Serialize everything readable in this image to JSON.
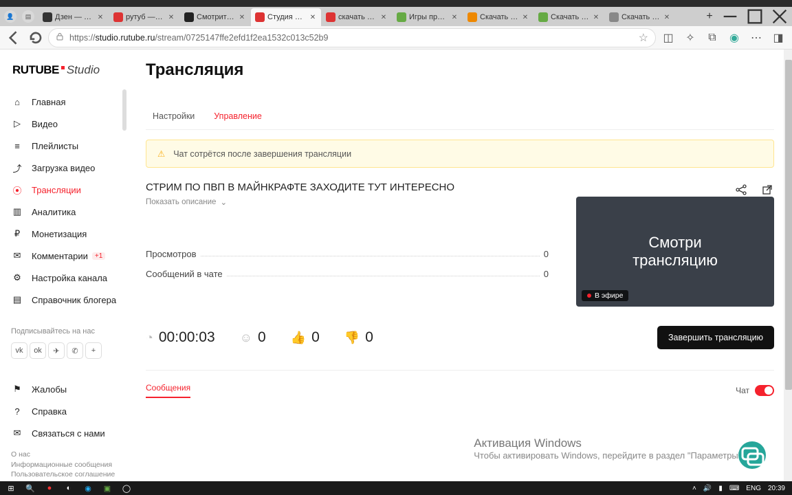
{
  "browser": {
    "tabs": [
      {
        "label": "Дзен — пла",
        "color": "#333"
      },
      {
        "label": "рутуб — Ян",
        "color": "#d33"
      },
      {
        "label": "Смотрите в",
        "color": "#222"
      },
      {
        "label": "Студия RUT",
        "color": "#d33",
        "active": true
      },
      {
        "label": "скачать игр",
        "color": "#d33"
      },
      {
        "label": "Игры про в",
        "color": "#6a4"
      },
      {
        "label": "Скачать игр",
        "color": "#e80"
      },
      {
        "label": "Скачать игр",
        "color": "#6a4"
      },
      {
        "label": "Скачать фа",
        "color": "#888"
      }
    ],
    "url_prefix": "https://",
    "url_host": "studio.rutube.ru",
    "url_path": "/stream/0725147ffe2efd1f2ea1532c013c52b9"
  },
  "logo": {
    "brand": "RUTUBE",
    "suffix": "Studio"
  },
  "sidebar": {
    "items": [
      {
        "label": "Главная",
        "icon": "home"
      },
      {
        "label": "Видео",
        "icon": "play"
      },
      {
        "label": "Плейлисты",
        "icon": "list"
      },
      {
        "label": "Загрузка видео",
        "icon": "upload"
      },
      {
        "label": "Трансляции",
        "icon": "broadcast",
        "active": true
      },
      {
        "label": "Аналитика",
        "icon": "chart"
      },
      {
        "label": "Монетизация",
        "icon": "ruble"
      },
      {
        "label": "Комментарии",
        "icon": "comment",
        "badge": "+1"
      },
      {
        "label": "Настройка канала",
        "icon": "gear"
      },
      {
        "label": "Справочник блогера",
        "icon": "book"
      }
    ],
    "subscribe": "Подписывайтесь на нас",
    "socials": [
      "vk",
      "ok",
      "tg",
      "vb",
      "plus"
    ],
    "lower": [
      {
        "label": "Жалобы",
        "icon": "flag"
      },
      {
        "label": "Справка",
        "icon": "help"
      },
      {
        "label": "Связаться с нами",
        "icon": "mail"
      }
    ],
    "footer": [
      "О нас",
      "Информационные сообщения",
      "Пользовательское соглашение"
    ]
  },
  "page": {
    "title": "Трансляция",
    "tabs": [
      {
        "label": "Настройки"
      },
      {
        "label": "Управление",
        "active": true
      }
    ],
    "alert": "Чат сотрётся после завершения трансляции",
    "stream_title": "СТРИМ ПО ПВП В МАЙНКРАФТЕ ЗАХОДИТЕ ТУТ ИНТЕРЕСНО",
    "show_description": "Показать описание",
    "stats": [
      {
        "label": "Просмотров",
        "value": "0"
      },
      {
        "label": "Сообщений в чате",
        "value": "0"
      }
    ],
    "preview_text_1": "Смотри",
    "preview_text_2": "трансляцию",
    "live_badge": "В эфире",
    "metrics": {
      "time": "00:00:03",
      "viewers": "0",
      "likes": "0",
      "dislikes": "0"
    },
    "end_button": "Завершить трансляцию",
    "chat_tab": "Сообщения",
    "chat_toggle_label": "Чат"
  },
  "watermark": {
    "title": "Активация Windows",
    "body": "Чтобы активировать Windows, перейдите в раздел \"Параметры\"."
  },
  "taskbar": {
    "lang": "ENG",
    "time": "20:39"
  }
}
